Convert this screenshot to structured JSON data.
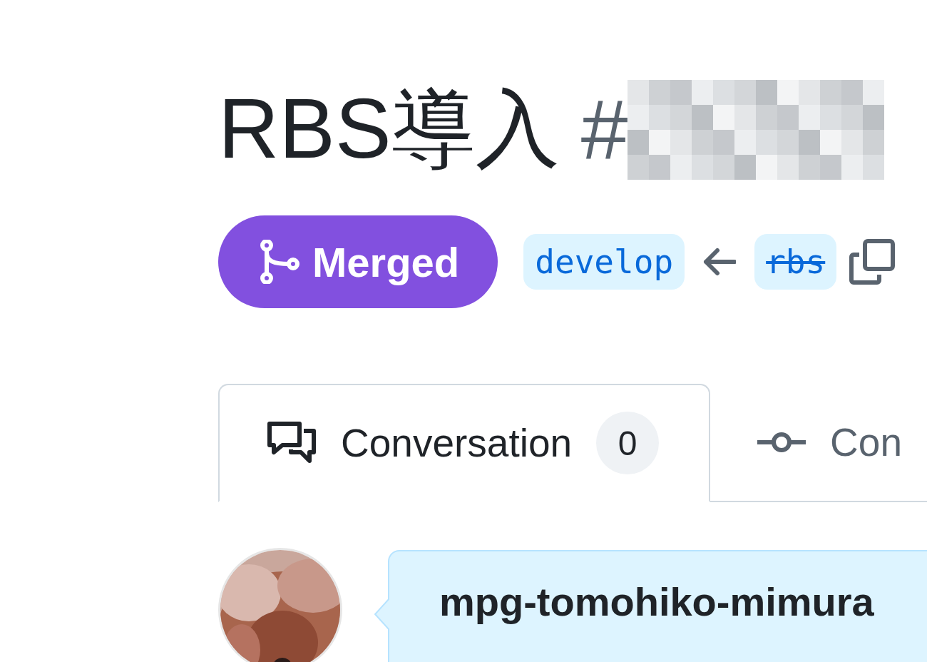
{
  "pr": {
    "title": "RBS導入",
    "number_prefix": "#",
    "status": {
      "kind": "merged",
      "label": "Merged"
    },
    "base_branch": "develop",
    "head_branch": {
      "name": "rbs",
      "deleted": true
    }
  },
  "tabs": [
    {
      "kind": "conversation",
      "label": "Conversation",
      "count": "0",
      "selected": true
    },
    {
      "kind": "commits",
      "label": "Con",
      "selected": false
    }
  ],
  "comment": {
    "author": "mpg-tomohiko-mimura"
  }
}
